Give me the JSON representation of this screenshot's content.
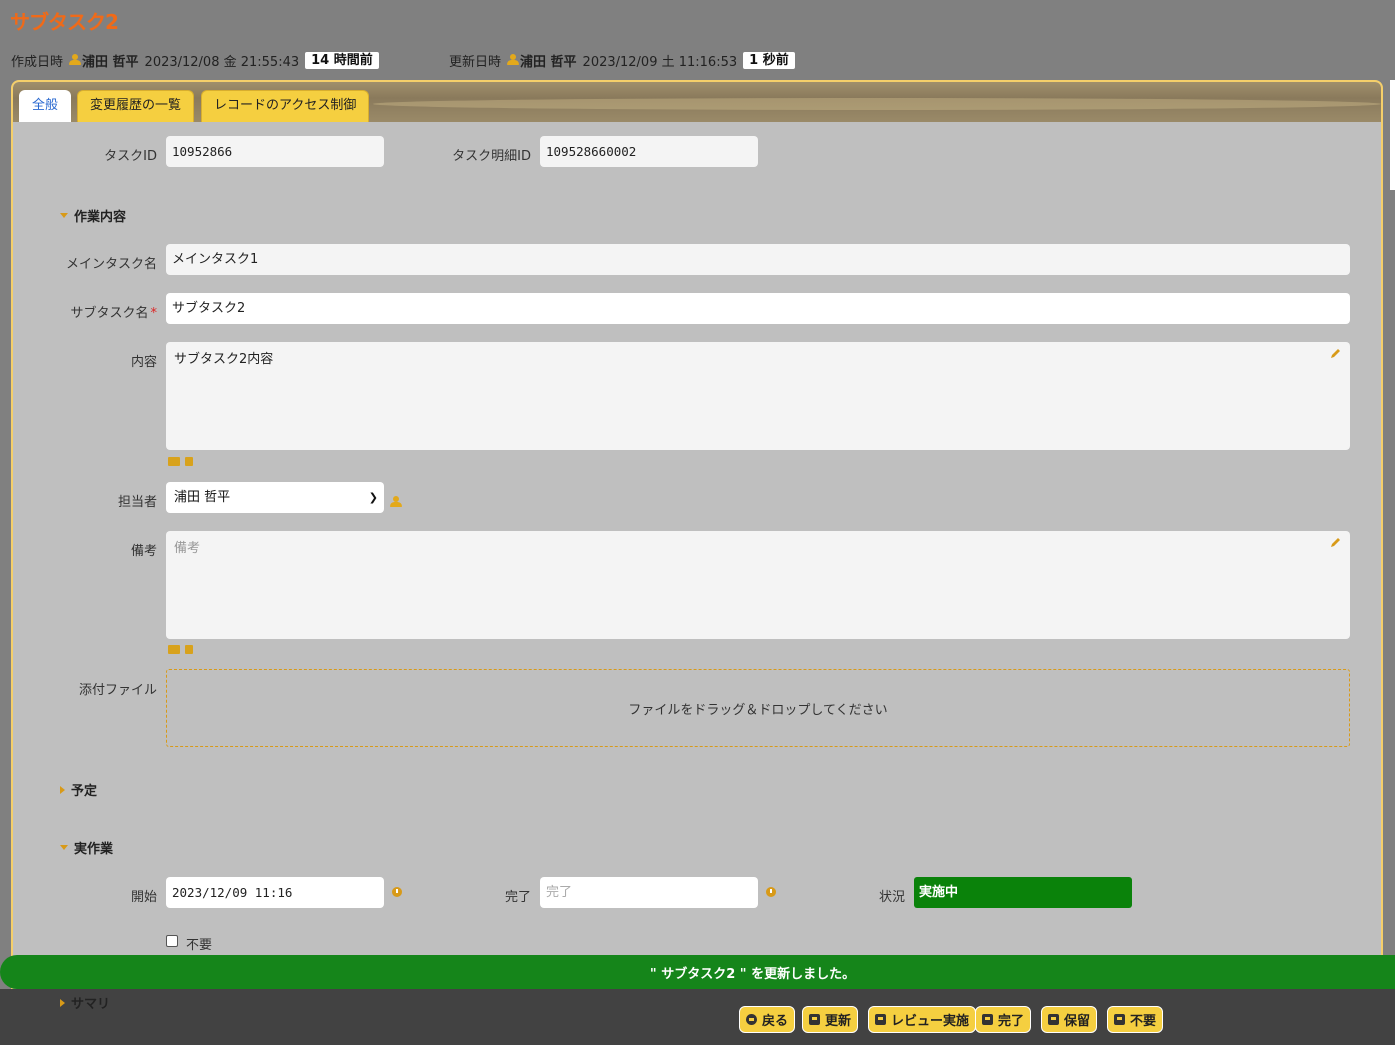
{
  "title": "サブタスク2",
  "created": {
    "label": "作成日時",
    "user": "浦田 哲平",
    "datetime": "2023/12/08 金 21:55:43",
    "ago": "14 時間前"
  },
  "updated": {
    "label": "更新日時",
    "user": "浦田 哲平",
    "datetime": "2023/12/09 土 11:16:53",
    "ago": "1 秒前"
  },
  "tabs": [
    "全般",
    "変更履歴の一覧",
    "レコードのアクセス制御"
  ],
  "fields": {
    "task_id": {
      "label": "タスクID",
      "value": "10952866"
    },
    "task_detail_id": {
      "label": "タスク明細ID",
      "value": "109528660002"
    },
    "main_task": {
      "label": "メインタスク名",
      "value": "メインタスク1"
    },
    "sub_task": {
      "label": "サブタスク名",
      "required": "*",
      "value": "サブタスク2"
    },
    "content": {
      "label": "内容",
      "value": "サブタスク2内容"
    },
    "assignee": {
      "label": "担当者",
      "value": "浦田 哲平"
    },
    "notes": {
      "label": "備考",
      "placeholder": "備考"
    },
    "attachment": {
      "label": "添付ファイル",
      "drop_text": "ファイルをドラッグ＆ドロップしてください"
    },
    "start": {
      "label": "開始",
      "value": "2023/12/09 11:16"
    },
    "end": {
      "label": "完了",
      "placeholder": "完了"
    },
    "status": {
      "label": "状況",
      "value": "実施中"
    },
    "unneeded": {
      "label": "不要"
    }
  },
  "sections": {
    "work": "作業内容",
    "plan": "予定",
    "actual": "実作業",
    "summary": "サマリ"
  },
  "toast": "\" サブタスク2 \" を更新しました。",
  "buttons": [
    "戻る",
    "更新",
    "レビュー実施",
    "完了",
    "保留",
    "不要"
  ],
  "colors": {
    "accent": "#f5cf40",
    "title": "#f06a18",
    "status": "#0a820a",
    "toast": "#15851a"
  }
}
